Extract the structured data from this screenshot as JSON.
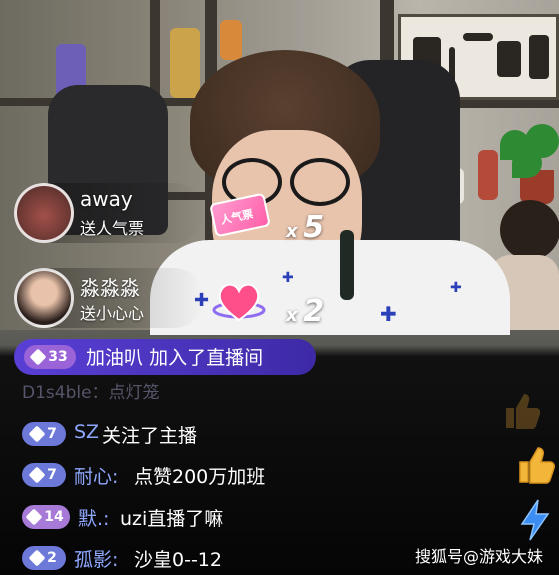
{
  "gifts": [
    {
      "user": "away",
      "action": "送人气票",
      "combo_x": "x",
      "combo_count": "5",
      "gift_icon": "popularity-ticket-icon",
      "ticket_text": "人气票"
    },
    {
      "user": "淼淼淼",
      "action": "送小心心",
      "combo_x": "x",
      "combo_count": "2",
      "gift_icon": "heart-icon"
    }
  ],
  "join_notice": {
    "level": "33",
    "user": "加油叭",
    "text": "加入了直播间"
  },
  "faded_line": "D1s4ble：点灯笼",
  "chat": [
    {
      "level": "7",
      "user": "SZ",
      "msg": "关注了主播",
      "badge_color": "#6c79d9"
    },
    {
      "level": "7",
      "user": "耐心:",
      "msg": "点赞200万加班",
      "badge_color": "#6c79d9"
    },
    {
      "level": "14",
      "user": "默.:",
      "msg": "uzi直播了嘛",
      "badge_color": "#a77ad8"
    },
    {
      "level": "2",
      "user": "孤影:",
      "msg": "沙皇0--12",
      "badge_color": "#6c79d9"
    }
  ],
  "watermark": "搜狐号@游戏大妹",
  "reactions": [
    "thumbs-up-icon",
    "lightning-icon"
  ],
  "colors": {
    "join_bar": "#5a3fd6",
    "username": "#8fa8ff",
    "chat_bg": "#000000"
  }
}
